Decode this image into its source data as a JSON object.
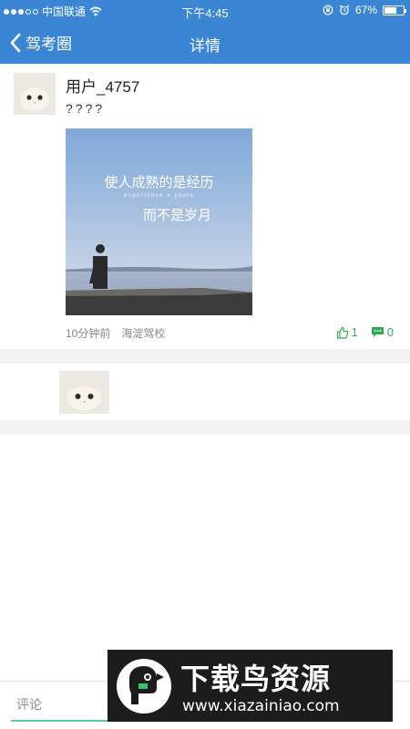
{
  "status_bar": {
    "carrier": "中国联通",
    "time": "下午4:45",
    "battery": "67%",
    "battery_level": 0.67
  },
  "nav": {
    "back_label": "驾考圈",
    "title": "详情"
  },
  "post": {
    "username": "用户_4757",
    "content": "????",
    "image_text": {
      "line1": "使人成熟的是经历",
      "subtext": "experience × years",
      "line2": "而不是岁月"
    },
    "time_ago": "10分钟前",
    "location": "海淀驾校",
    "like_count": "1",
    "comment_count": "0"
  },
  "comment_bar": {
    "placeholder": "评论"
  },
  "watermark": {
    "title": "下载鸟资源",
    "url": "www.xiazainiao.com"
  },
  "colors": {
    "header_blue": "#3a86d4",
    "action_green": "#2fae4f",
    "input_underline": "#5fc7a2"
  }
}
